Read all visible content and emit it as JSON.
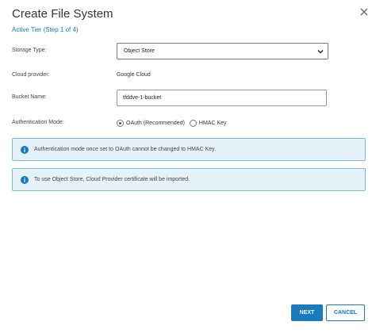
{
  "dialog": {
    "title": "Create File System",
    "subtitle": "Active Tier (Step 1 of 4)",
    "close_icon": "close-icon"
  },
  "form": {
    "storage_type_label": "Storage Type:",
    "storage_type_value": "Object Store",
    "cloud_provider_label": "Cloud provider:",
    "cloud_provider_value": "Google Cloud",
    "bucket_name_label": "Bucket Name:",
    "bucket_name_value": "tfddve-1-bucket",
    "auth_mode_label": "Authentication Mode:",
    "auth_options": [
      {
        "label": "OAuth (Recommended)",
        "selected": true
      },
      {
        "label": "HMAC Key",
        "selected": false
      }
    ]
  },
  "notices": [
    {
      "icon": "info-icon",
      "text": "Authentication mode once set to OAuth cannot be changed to HMAC Key."
    },
    {
      "icon": "info-icon",
      "text": "To use Object Store, Cloud Provider certificate will be imported."
    }
  ],
  "footer": {
    "next_label": "NEXT",
    "cancel_label": "CANCEL"
  },
  "colors": {
    "accent": "#1a7abf",
    "info_bg": "#e6f2fa",
    "info_border": "#7fb8e0"
  }
}
